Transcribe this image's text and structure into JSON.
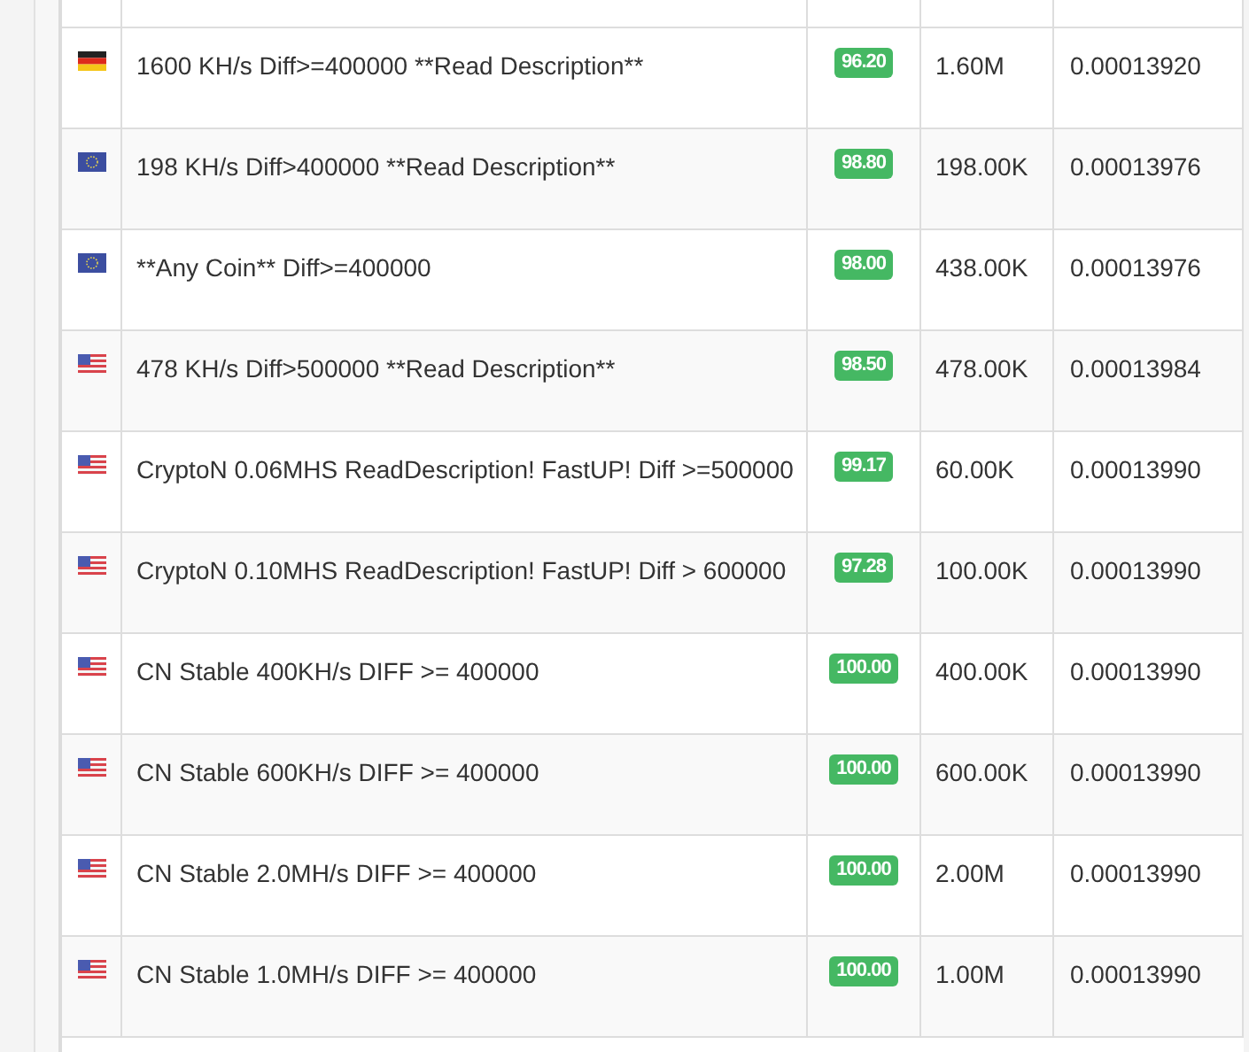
{
  "rows": [
    {
      "kind": "de",
      "name": "1600 KH/s Diff>=400000 **Read Description**",
      "score": "96.20",
      "hashrate": "1.60M",
      "price": "0.00013920"
    },
    {
      "kind": "eu",
      "name": "198 KH/s Diff>400000 **Read Description**",
      "score": "98.80",
      "hashrate": "198.00K",
      "price": "0.00013976"
    },
    {
      "kind": "eu",
      "name": "**Any Coin** Diff>=400000",
      "score": "98.00",
      "hashrate": "438.00K",
      "price": "0.00013976"
    },
    {
      "kind": "us",
      "name": "478 KH/s Diff>500000 **Read Description**",
      "score": "98.50",
      "hashrate": "478.00K",
      "price": "0.00013984"
    },
    {
      "kind": "us",
      "name": "CryptoN 0.06MHS ReadDescription! FastUP! Diff >=500000",
      "score": "99.17",
      "hashrate": "60.00K",
      "price": "0.00013990"
    },
    {
      "kind": "us",
      "name": "CryptoN 0.10MHS ReadDescription! FastUP! Diff > 600000",
      "score": "97.28",
      "hashrate": "100.00K",
      "price": "0.00013990"
    },
    {
      "kind": "us",
      "name": "CN Stable 400KH/s DIFF >= 400000",
      "score": "100.00",
      "hashrate": "400.00K",
      "price": "0.00013990"
    },
    {
      "kind": "us",
      "name": "CN Stable 600KH/s DIFF >= 400000",
      "score": "100.00",
      "hashrate": "600.00K",
      "price": "0.00013990"
    },
    {
      "kind": "us",
      "name": "CN Stable 2.0MH/s DIFF >= 400000",
      "score": "100.00",
      "hashrate": "2.00M",
      "price": "0.00013990"
    },
    {
      "kind": "us",
      "name": "CN Stable 1.0MH/s DIFF >= 400000",
      "score": "100.00",
      "hashrate": "1.00M",
      "price": "0.00013990"
    }
  ]
}
